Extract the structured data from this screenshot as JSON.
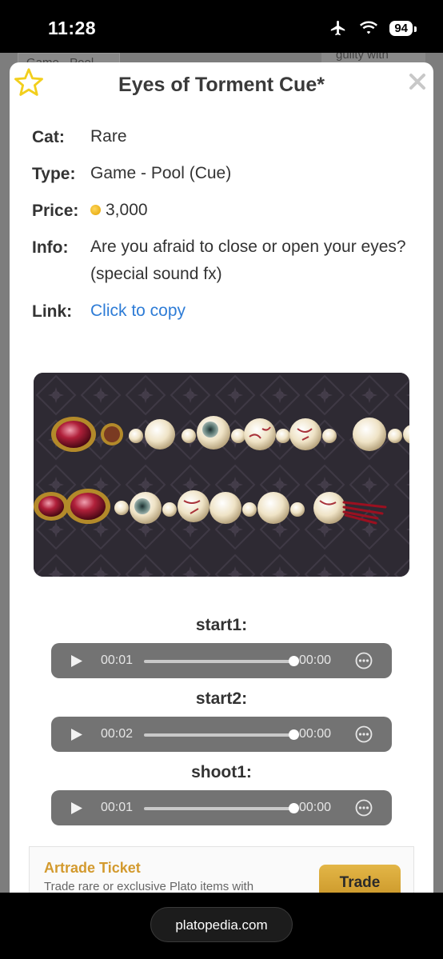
{
  "status_bar": {
    "time": "11:28",
    "battery": "94"
  },
  "background": {
    "left_text": "Game - Pool",
    "right_text": "guilty with"
  },
  "item": {
    "title": "Eyes of Torment Cue*",
    "cat_label": "Cat:",
    "cat_value": "Rare",
    "type_label": "Type:",
    "type_value": "Game - Pool (Cue)",
    "price_label": "Price:",
    "price_value": "3,000",
    "info_label": "Info:",
    "info_value": "Are you afraid to close or open your eyes? (special sound fx)",
    "link_label": "Link:",
    "link_value": "Click to copy"
  },
  "audio": [
    {
      "label": "start1:",
      "current": "00:01",
      "end": "00:00"
    },
    {
      "label": "start2:",
      "current": "00:02",
      "end": "00:00"
    },
    {
      "label": "shoot1:",
      "current": "00:01",
      "end": "00:00"
    }
  ],
  "ad": {
    "title": "Artrade Ticket",
    "subtitle": "Trade rare or exclusive Plato items with",
    "button": "Trade"
  },
  "browser": {
    "url": "platopedia.com"
  },
  "colors": {
    "link": "#2e7cd6",
    "star": "#f2cf1d",
    "ad_title": "#d39a2e",
    "player_bg": "#737373"
  }
}
